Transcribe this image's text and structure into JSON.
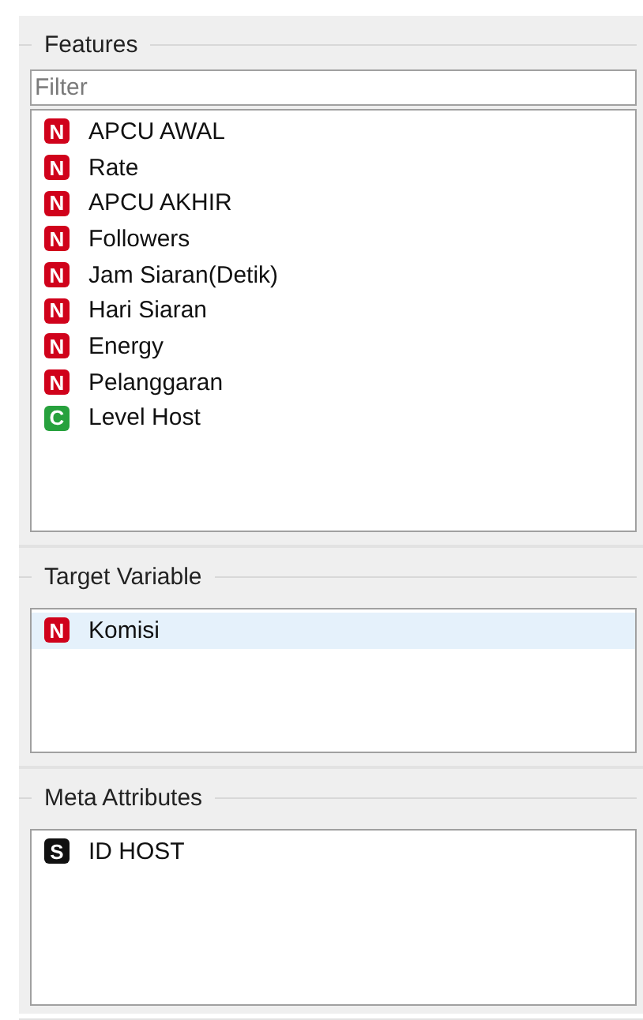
{
  "sections": [
    {
      "title": "Features",
      "filter": {
        "placeholder": "Filter"
      },
      "items": [
        {
          "badge": "N",
          "kind": "numeric",
          "label": "APCU AWAL",
          "selected": false
        },
        {
          "badge": "N",
          "kind": "numeric",
          "label": "Rate",
          "selected": false
        },
        {
          "badge": "N",
          "kind": "numeric",
          "label": "APCU AKHIR",
          "selected": false
        },
        {
          "badge": "N",
          "kind": "numeric",
          "label": "Followers",
          "selected": false
        },
        {
          "badge": "N",
          "kind": "numeric",
          "label": "Jam Siaran(Detik)",
          "selected": false
        },
        {
          "badge": "N",
          "kind": "numeric",
          "label": "Hari Siaran",
          "selected": false
        },
        {
          "badge": "N",
          "kind": "numeric",
          "label": "Energy",
          "selected": false
        },
        {
          "badge": "N",
          "kind": "numeric",
          "label": "Pelanggaran",
          "selected": false
        },
        {
          "badge": "C",
          "kind": "categorical",
          "label": "Level Host",
          "selected": false
        }
      ]
    },
    {
      "title": "Target Variable",
      "items": [
        {
          "badge": "N",
          "kind": "numeric",
          "label": "Komisi",
          "selected": true
        }
      ]
    },
    {
      "title": "Meta Attributes",
      "items": [
        {
          "badge": "S",
          "kind": "string",
          "label": "ID HOST",
          "selected": false
        }
      ]
    }
  ]
}
